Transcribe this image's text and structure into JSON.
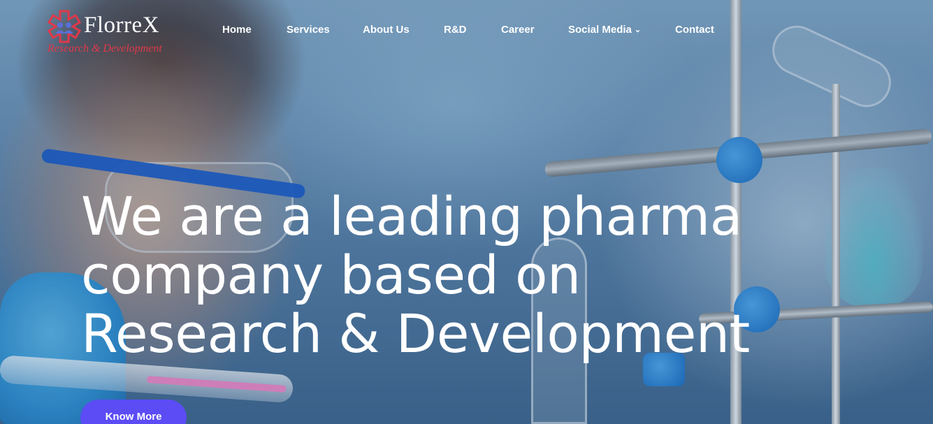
{
  "brand": {
    "name": "FlorreX",
    "tagline": "Research & Development",
    "logo_icon": "medical-star-people-icon",
    "tagline_color": "#e0394a"
  },
  "nav": {
    "items": [
      {
        "label": "Home"
      },
      {
        "label": "Services"
      },
      {
        "label": "About Us"
      },
      {
        "label": "R&D"
      },
      {
        "label": "Career"
      },
      {
        "label": "Social Media",
        "has_dropdown": true,
        "icon": "chevron-down-icon"
      },
      {
        "label": "Contact"
      }
    ]
  },
  "hero": {
    "headline_lines": [
      "We are a leading pharma",
      "company based on",
      "Research & Development"
    ],
    "cta_label": "Know More",
    "cta_color": "#5b4cf5"
  }
}
